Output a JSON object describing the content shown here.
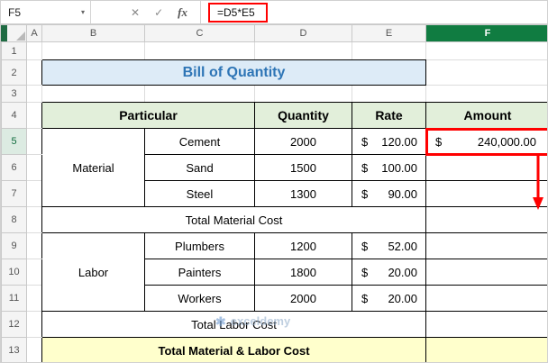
{
  "formula_bar": {
    "name_box": "F5",
    "name_box_caret": "▾",
    "cancel_icon": "✕",
    "enter_icon": "✓",
    "fx_icon": "fx",
    "formula": "=D5*E5"
  },
  "grid": {
    "columns": [
      "A",
      "B",
      "C",
      "D",
      "E",
      "F"
    ],
    "rows": [
      "1",
      "2",
      "3",
      "4",
      "5",
      "6",
      "7",
      "8",
      "9",
      "10",
      "11",
      "12",
      "13"
    ],
    "selected_cell": "F5"
  },
  "sheet": {
    "title": "Bill of Quantity",
    "header": {
      "particular": "Particular",
      "quantity": "Quantity",
      "rate": "Rate",
      "amount": "Amount"
    },
    "material_label": "Material",
    "labor_label": "Labor",
    "material_rows": [
      {
        "item": "Cement",
        "qty": "2000",
        "cur": "$",
        "rate": "120.00"
      },
      {
        "item": "Sand",
        "qty": "1500",
        "cur": "$",
        "rate": "100.00"
      },
      {
        "item": "Steel",
        "qty": "1300",
        "cur": "$",
        "rate": "90.00"
      }
    ],
    "labor_rows": [
      {
        "item": "Plumbers",
        "qty": "1200",
        "cur": "$",
        "rate": "52.00"
      },
      {
        "item": "Painters",
        "qty": "1800",
        "cur": "$",
        "rate": "20.00"
      },
      {
        "item": "Workers",
        "qty": "2000",
        "cur": "$",
        "rate": "20.00"
      }
    ],
    "f5_amount": {
      "cur": "$",
      "value": "240,000.00"
    },
    "total_material": "Total Material Cost",
    "total_labor": "Total Labor Cost",
    "grand_total": "Total Material & Labor Cost"
  },
  "watermark": {
    "logo_icon": "✱",
    "text": "exceldemy"
  },
  "colors": {
    "title_text": "#2E75B6",
    "title_bg": "#DDEBF7",
    "header_bg": "#E2EFDA",
    "grand_total_bg": "#FFFFCC",
    "selected_col_header_bg": "#107C41",
    "annotation_red": "#FF0000"
  }
}
